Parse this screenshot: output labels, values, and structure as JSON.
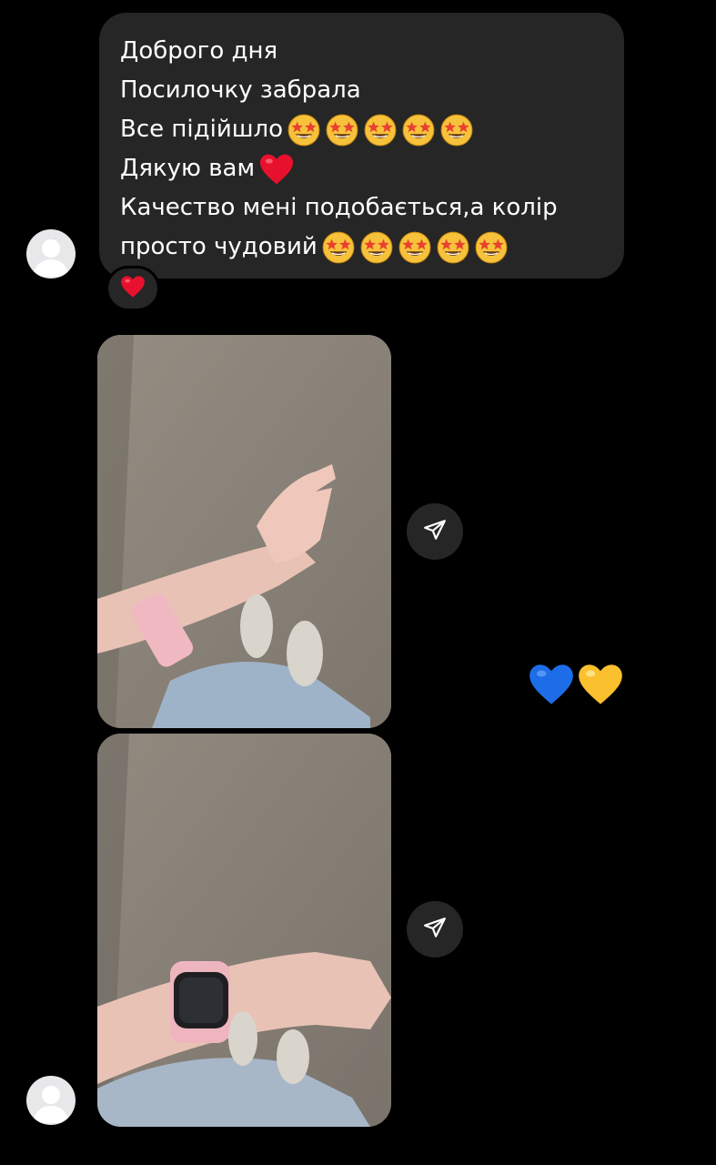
{
  "message": {
    "lines": [
      {
        "text": "Доброго дня",
        "emoji": []
      },
      {
        "text": "Посилочку забрала",
        "emoji": []
      },
      {
        "text": "Все підійшло",
        "emoji": [
          "star-struck",
          "star-struck",
          "star-struck",
          "star-struck",
          "star-struck"
        ]
      },
      {
        "text": "Дякую вам",
        "emoji": [
          "red-heart"
        ]
      },
      {
        "text": "Качество мені подобається,а колір",
        "emoji": []
      },
      {
        "text": "просто чудовий",
        "emoji": [
          "star-struck",
          "star-struck",
          "star-struck",
          "star-struck",
          "star-struck"
        ]
      }
    ],
    "reaction": "red-heart"
  },
  "photos": [
    {
      "description_icon": "photo",
      "share_icon": "send-icon"
    },
    {
      "description_icon": "photo",
      "share_icon": "send-icon"
    }
  ],
  "reply": {
    "emoji": [
      "blue-heart",
      "yellow-heart"
    ]
  },
  "colors": {
    "background": "#000000",
    "bubble": "#262626",
    "text": "#ffffff",
    "heart_red": "#e8112d",
    "heart_blue": "#1d6de8",
    "heart_yellow": "#fbc02d"
  }
}
